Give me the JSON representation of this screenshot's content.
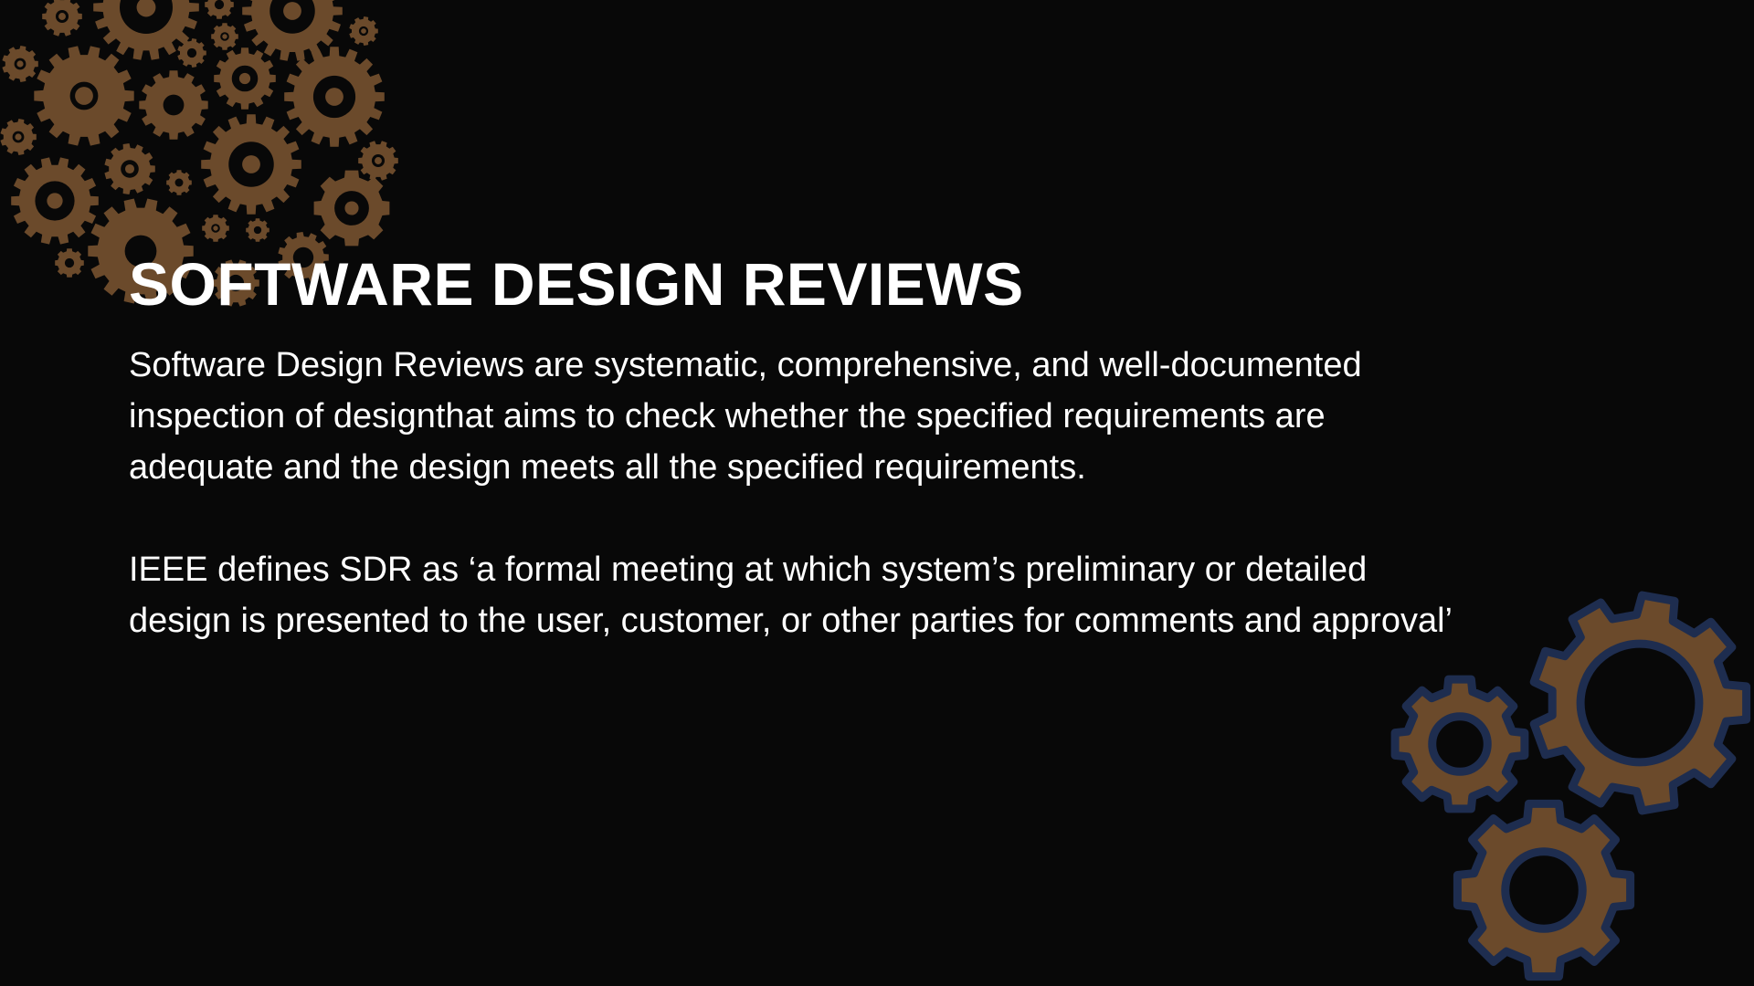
{
  "slide": {
    "title": "SOFTWARE DESIGN REVIEWS",
    "paragraphs": [
      " Software Design Reviews are systematic, comprehensive, and well-documented\ninspection of designthat aims to check whether the specified requirements are\nadequate and the design meets all the specified requirements.",
      "IEEE defines SDR as ‘a formal meeting at which system’s preliminary or detailed\ndesign is presented to the user, customer, or other parties for comments and approval’"
    ]
  },
  "decorations": {
    "gear_color": "#6b4a2b",
    "gear_outline_color": "#1e2d4f",
    "top_left": "gear-cluster-icon",
    "bottom_right": "gear-trio-icon"
  },
  "colors": {
    "background": "#080808",
    "text": "#ffffff"
  }
}
